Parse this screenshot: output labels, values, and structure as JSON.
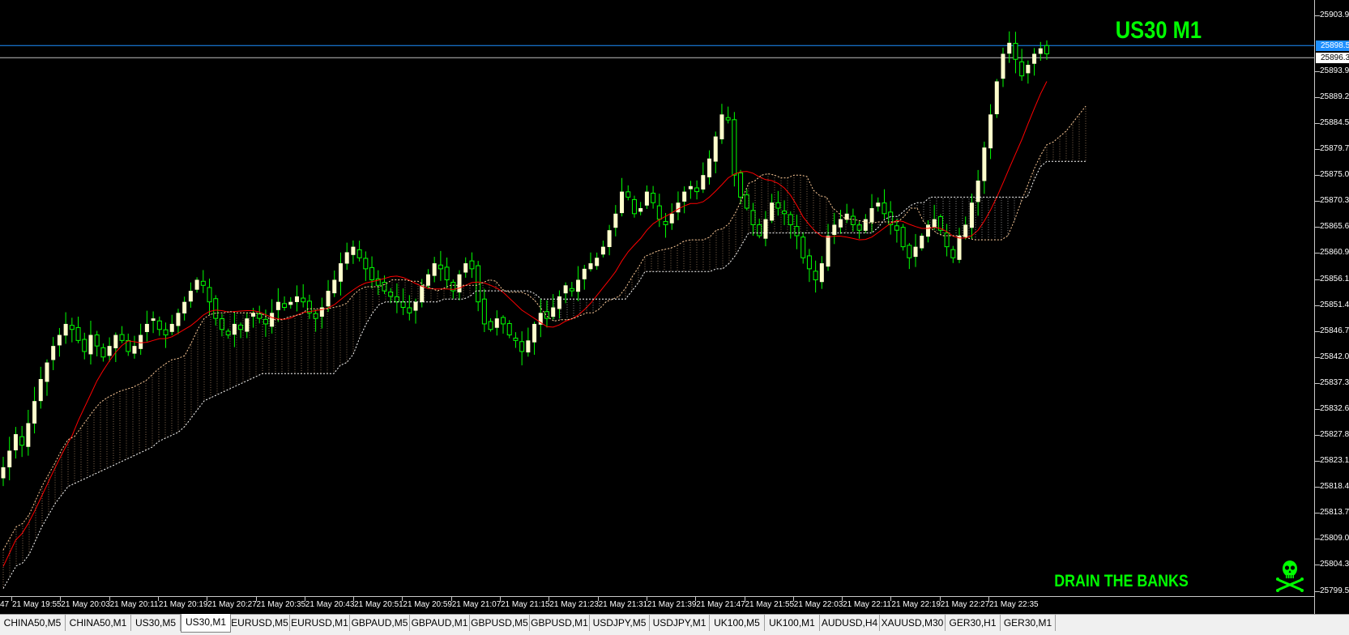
{
  "window": {
    "symbol_title": "US30 M1",
    "watermark": "DRAIN THE BANKS",
    "watermark_icon": "skull-crossbones-icon"
  },
  "colors": {
    "background": "#000000",
    "bull_candle": "#ffffcc",
    "bear_wick": "#00ff00",
    "sma_line": "#ff0000",
    "cloud_a": "#ffcc99",
    "cloud_b": "#ffffff",
    "bid_line": "#1e90ff",
    "ask_line": "#c0c0c0",
    "title_color": "#00ff00"
  },
  "price_axis": {
    "labels": [
      "25903.90",
      "25898.50",
      "25896.30",
      "25893.90",
      "25889.20",
      "25884.50",
      "25879.70",
      "25875.00",
      "25870.30",
      "25865.60",
      "25860.90",
      "25856.10",
      "25851.40",
      "25846.70",
      "25842.00",
      "25837.30",
      "25832.60",
      "25827.80",
      "25823.10",
      "25818.40",
      "25813.70",
      "25809.00",
      "25804.30",
      "25799.50"
    ],
    "bid_marker": "25898.50",
    "ask_marker": "25896.30"
  },
  "time_axis": {
    "labels": [
      "47",
      "21 May 19:55",
      "21 May 20:03",
      "21 May 20:11",
      "21 May 20:19",
      "21 May 20:27",
      "21 May 20:35",
      "21 May 20:43",
      "21 May 20:51",
      "21 May 20:59",
      "21 May 21:07",
      "21 May 21:15",
      "21 May 21:23",
      "21 May 21:31",
      "21 May 21:39",
      "21 May 21:47",
      "21 May 21:55",
      "21 May 22:03",
      "21 May 22:11",
      "21 May 22:19",
      "21 May 22:27",
      "21 May 22:35"
    ]
  },
  "tabs": [
    {
      "label": "CHINA50,M5",
      "active": false
    },
    {
      "label": "CHINA50,M1",
      "active": false
    },
    {
      "label": "US30,M5",
      "active": false
    },
    {
      "label": "US30,M1",
      "active": true
    },
    {
      "label": "EURUSD,M5",
      "active": false
    },
    {
      "label": "EURUSD,M1",
      "active": false
    },
    {
      "label": "GBPAUD,M5",
      "active": false
    },
    {
      "label": "GBPAUD,M1",
      "active": false
    },
    {
      "label": "GBPUSD,M5",
      "active": false
    },
    {
      "label": "GBPUSD,M1",
      "active": false
    },
    {
      "label": "USDJPY,M5",
      "active": false
    },
    {
      "label": "USDJPY,M1",
      "active": false
    },
    {
      "label": "UK100,M5",
      "active": false
    },
    {
      "label": "UK100,M1",
      "active": false
    },
    {
      "label": "AUDUSD,H4",
      "active": false
    },
    {
      "label": "XAUUSD,M30",
      "active": false
    },
    {
      "label": "GER30,H1",
      "active": false
    },
    {
      "label": "GER30,M1",
      "active": false
    }
  ],
  "chart_data": {
    "type": "candlestick",
    "symbol": "US30",
    "timeframe": "M1",
    "ylim": [
      25799.5,
      25905.0
    ],
    "bid": 25898.5,
    "ask": 25896.3,
    "closes": [
      25822,
      25825,
      25828,
      25826,
      25830,
      25834,
      25838,
      25841,
      25844,
      25846,
      25848,
      25847,
      25845,
      25843,
      25846,
      25844,
      25842,
      25844,
      25846,
      25845,
      25843,
      25844,
      25846,
      25848,
      25849,
      25847,
      25846,
      25848,
      25850,
      25852,
      25854,
      25856,
      25855,
      25852,
      25849,
      25847,
      25846,
      25848,
      25847,
      25849,
      25850,
      25849,
      25848,
      25850,
      25852,
      25851,
      25852,
      25853,
      25852,
      25850,
      25849,
      25851,
      25854,
      25856,
      25859,
      25861,
      25862,
      25860,
      25858,
      25856,
      25855,
      25854,
      25853,
      25852,
      25851,
      25850,
      25852,
      25855,
      25857,
      25859,
      25858,
      25856,
      25854,
      25857,
      25859,
      25858,
      25852,
      25848,
      25847,
      25849,
      25848,
      25846,
      25845,
      25843,
      25845,
      25848,
      25850,
      25849,
      25851,
      25853,
      25855,
      25854,
      25856,
      25858,
      25859,
      25860,
      25862,
      25865,
      25868,
      25872,
      25871,
      25868,
      25869,
      25872,
      25870,
      25867,
      25866,
      25868,
      25870,
      25872,
      25873,
      25872,
      25875,
      25878,
      25882,
      25886,
      25885,
      25875,
      25871,
      25869,
      25866,
      25864,
      25867,
      25870,
      25869,
      25868,
      25866,
      25864,
      25860,
      25858,
      25856,
      25859,
      25864,
      25866,
      25867,
      25868,
      25866,
      25865,
      25867,
      25869,
      25870,
      25868,
      25866,
      25865,
      25862,
      25860,
      25862,
      25864,
      25866,
      25867,
      25865,
      25862,
      25860,
      25864,
      25866,
      25870,
      25874,
      25880,
      25886,
      25892,
      25897,
      25899,
      25896,
      25893,
      25895,
      25897,
      25898,
      25897
    ]
  }
}
